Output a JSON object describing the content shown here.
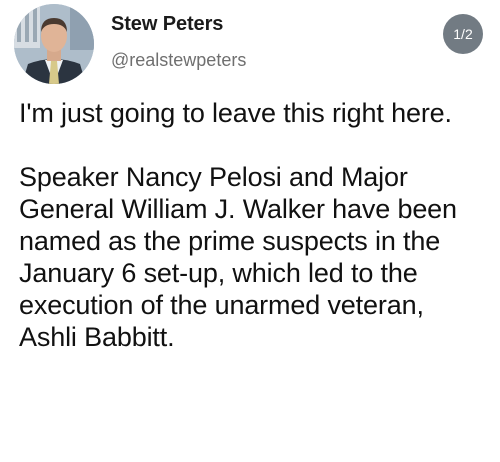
{
  "author": {
    "display_name": "Stew Peters",
    "handle": "@realstewpeters"
  },
  "thread_position": "1/2",
  "body": {
    "intro": "I'm just going to leave this right here.",
    "statement": "Speaker Nancy Pelosi and Major General William J. Walker have been named as the prime suspects in the January 6 set-up, which led to the execution of the unarmed veteran, Ashli Babbitt."
  },
  "colors": {
    "text": "#111111",
    "handle": "#6f6f6f",
    "badge": "#727b83",
    "background": "#ffffff"
  },
  "icons": {
    "avatar": "profile-photo"
  }
}
